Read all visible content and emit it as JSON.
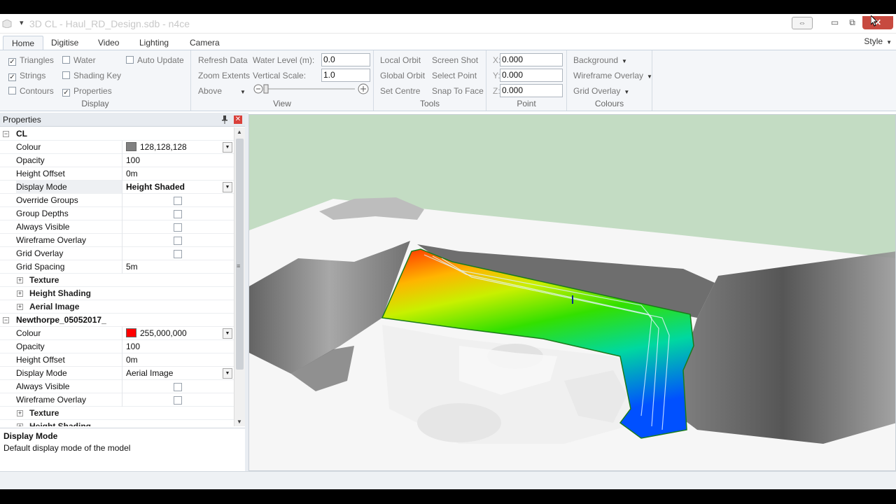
{
  "window": {
    "title": "3D CL - Haul_RD_Design.sdb - n4ce",
    "quick_access": "▾",
    "restore_symbol": "⇔",
    "minimize_symbol": "▭",
    "maximize_symbol": "⧉",
    "close_symbol": "✕"
  },
  "ribbon": {
    "tabs": [
      "Home",
      "Digitise",
      "Video",
      "Lighting",
      "Camera"
    ],
    "active_tab": "Home",
    "style_menu": "Style",
    "display": {
      "label": "Display",
      "triangles": {
        "label": "Triangles",
        "checked": true
      },
      "strings": {
        "label": "Strings",
        "checked": true
      },
      "contours": {
        "label": "Contours",
        "checked": false
      },
      "water": {
        "label": "Water",
        "checked": false
      },
      "shading_key": {
        "label": "Shading Key",
        "checked": false
      },
      "properties": {
        "label": "Properties",
        "checked": true
      },
      "auto_update": {
        "label": "Auto Update",
        "checked": false
      }
    },
    "view": {
      "label": "View",
      "refresh_data": "Refresh Data",
      "zoom_extents": "Zoom Extents",
      "above": "Above",
      "water_level_label": "Water Level (m):",
      "water_level_value": "0.0",
      "vertical_scale_label": "Vertical Scale:",
      "vertical_scale_value": "1.0"
    },
    "tools": {
      "label": "Tools",
      "local_orbit": "Local Orbit",
      "global_orbit": "Global Orbit",
      "set_centre": "Set Centre",
      "screen_shot": "Screen Shot",
      "select_point": "Select Point",
      "snap_to_face": "Snap To Face"
    },
    "point": {
      "label": "Point",
      "x_label": "X:",
      "x_value": "0.000",
      "y_label": "Y:",
      "y_value": "0.000",
      "z_label": "Z:",
      "z_value": "0.000"
    },
    "colours": {
      "label": "Colours",
      "background": "Background",
      "wireframe_overlay": "Wireframe Overlay",
      "grid_overlay": "Grid Overlay"
    }
  },
  "properties": {
    "title": "Properties",
    "pin_symbol": "📌",
    "close_symbol": "✕",
    "expander_minus": "−",
    "expander_plus": "+",
    "dropdown_symbol": "▼",
    "grip_symbol": "≡",
    "scroll_up": "▲",
    "scroll_down": "▼",
    "groups": [
      {
        "name": "CL",
        "rows": {
          "colour": {
            "label": "Colour",
            "value": "128,128,128",
            "swatch": "#808080"
          },
          "opacity": {
            "label": "Opacity",
            "value": "100"
          },
          "height_offset": {
            "label": "Height Offset",
            "value": "0m"
          },
          "display_mode": {
            "label": "Display Mode",
            "value": "Height Shaded"
          },
          "override_groups": {
            "label": "Override Groups",
            "checked": false
          },
          "group_depths": {
            "label": "Group Depths",
            "checked": false
          },
          "always_visible": {
            "label": "Always Visible",
            "checked": false
          },
          "wireframe_overlay": {
            "label": "Wireframe Overlay",
            "checked": false
          },
          "grid_overlay": {
            "label": "Grid Overlay",
            "checked": false
          },
          "grid_spacing": {
            "label": "Grid Spacing",
            "value": "5m"
          },
          "texture": "Texture",
          "height_shading": "Height Shading",
          "aerial_image": "Aerial Image"
        }
      },
      {
        "name": "Newthorpe_05052017_",
        "rows": {
          "colour": {
            "label": "Colour",
            "value": "255,000,000",
            "swatch": "#ff0000"
          },
          "opacity": {
            "label": "Opacity",
            "value": "100"
          },
          "height_offset": {
            "label": "Height Offset",
            "value": "0m"
          },
          "display_mode": {
            "label": "Display Mode",
            "value": "Aerial Image"
          },
          "always_visible": {
            "label": "Always Visible",
            "checked": false
          },
          "wireframe_overlay": {
            "label": "Wireframe Overlay",
            "checked": false
          },
          "texture": "Texture",
          "height_shading": "Height Shading"
        }
      }
    ],
    "description": {
      "title": "Display Mode",
      "text": "Default display mode of the model"
    }
  },
  "colors": {
    "accent": "#c9d3df",
    "close_red": "#c74a40",
    "sky": "#c3dcc3"
  }
}
